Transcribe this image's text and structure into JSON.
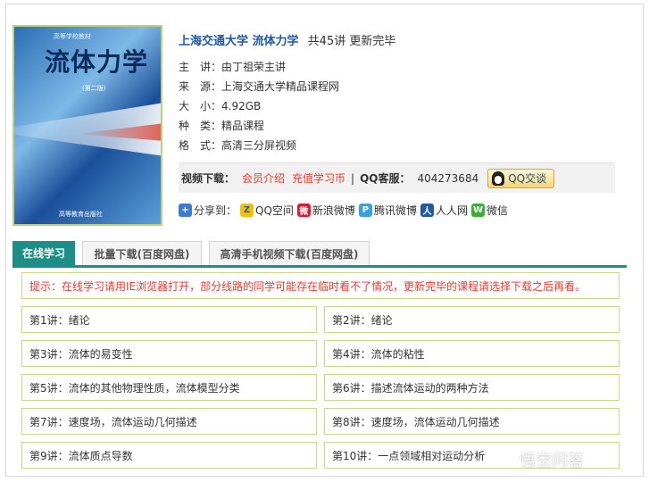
{
  "cover": {
    "small_top": "高等学校教材",
    "title": "流体力学",
    "edition": "(第二版)",
    "publisher": "高等教育出版社"
  },
  "header": {
    "course": "上海交通大学 流体力学",
    "meta": "共45讲 更新完毕"
  },
  "info": [
    {
      "key": "主　讲：",
      "value": "由丁祖荣主讲"
    },
    {
      "key": "来　源：",
      "value": "上海交通大学精品课程网"
    },
    {
      "key": "大　小：",
      "value": "4.92GB"
    },
    {
      "key": "种　类：",
      "value": "精品课程"
    },
    {
      "key": "格　式：",
      "value": "高清三分屏视频"
    }
  ],
  "download": {
    "label": "视频下载：",
    "member": "会员介绍",
    "recharge": "充值学习币",
    "sep": "|",
    "qq_label": "QQ客服：",
    "qq_number": "404273684",
    "qq_button": "QQ交谈"
  },
  "share": {
    "label": "分享到：",
    "items": [
      "QQ空间",
      "新浪微博",
      "腾讯微博",
      "人人网",
      "微信"
    ]
  },
  "tabs": [
    "在线学习",
    "批量下载(百度网盘)",
    "高清手机视频下载(百度网盘)"
  ],
  "notice": "提示：在线学习请用IE浏览器打开，部分线路的同学可能存在临时看不了情况，更新完毕的课程请选择下载之后再看。",
  "lectures": [
    "第1讲：绪论",
    "第2讲：绪论",
    "第3讲：流体的易变性",
    "第4讲：流体的粘性",
    "第5讲：流体的其他物理性质，流体模型分类",
    "第6讲：描述流体运动的两种方法",
    "第7讲：速度场，流体运动几何描述",
    "第8讲：速度场，流体运动几何描述",
    "第9讲：流体质点导数",
    "第10讲：一点领域相对运动分析"
  ],
  "watermark": "悟空问答",
  "colors": {
    "accent": "#1d8f86",
    "link": "#1f5aa6",
    "red": "#e63b2e",
    "border": "#c6d987"
  }
}
